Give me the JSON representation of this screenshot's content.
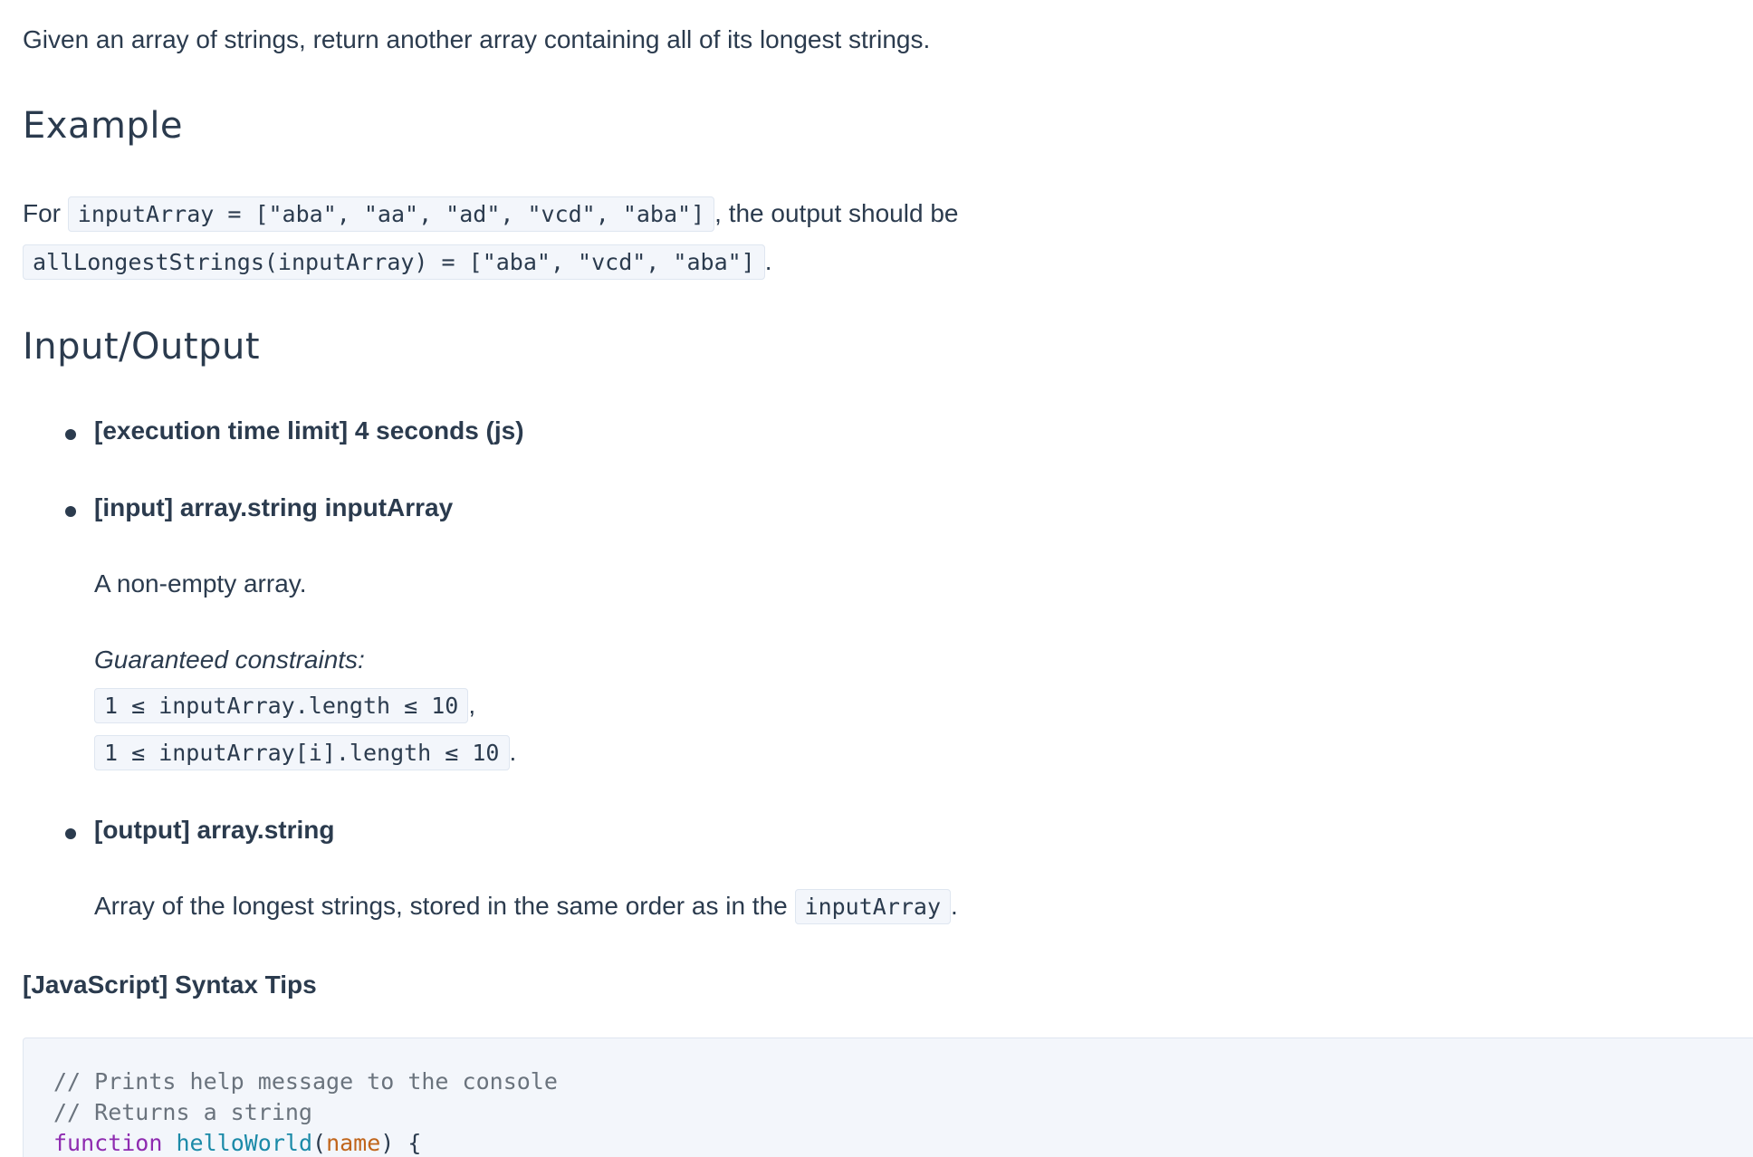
{
  "intro": "Given an array of strings, return another array containing all of its longest strings.",
  "example": {
    "heading": "Example",
    "for_text": "For",
    "input_code": "inputArray = [\"aba\", \"aa\", \"ad\", \"vcd\", \"aba\"]",
    "mid_text": ", the output should be",
    "output_code": "allLongestStrings(inputArray) = [\"aba\", \"vcd\", \"aba\"]",
    "end_text": "."
  },
  "io": {
    "heading": "Input/Output",
    "time_limit": "[execution time limit] 4 seconds (js)",
    "input_label": "[input] array.string inputArray",
    "input_desc": "A non-empty array.",
    "constraints_label": "Guaranteed constraints:",
    "constraint_1": "1 ≤ inputArray.length ≤ 10",
    "constraint_1_sep": ",",
    "constraint_2": "1 ≤ inputArray[i].length ≤ 10",
    "constraint_2_sep": ".",
    "output_label": "[output] array.string",
    "output_desc": "Array of the longest strings, stored in the same order as in the",
    "output_code": "inputArray",
    "output_end": "."
  },
  "tips": {
    "heading": "[JavaScript] Syntax Tips",
    "comment_1": "// Prints help message to the console",
    "comment_2": "// Returns a string",
    "kw_function": "function",
    "fn_name": "helloWorld",
    "paren_open": "(",
    "param": "name",
    "paren_close": ") {"
  }
}
